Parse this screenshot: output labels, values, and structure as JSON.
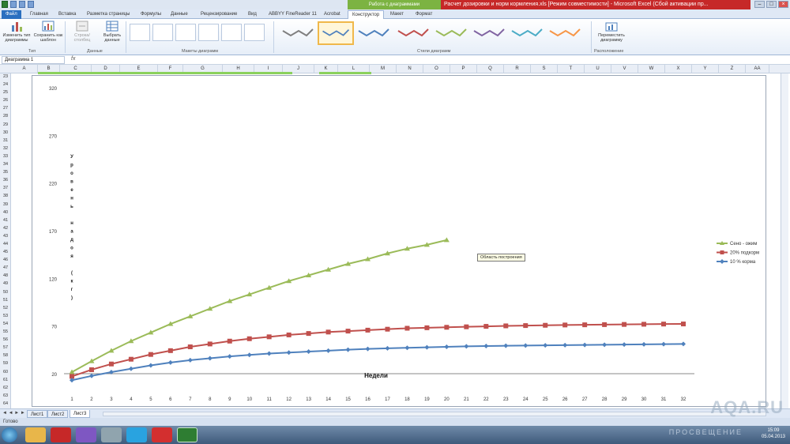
{
  "window": {
    "title": "Расчет дозировки и норм кормления.xls [Режим совместимости] - Microsoft Excel (Сбой активации пр...",
    "context_group": "Работа с диаграммами"
  },
  "ribbon": {
    "tabs": [
      "Файл",
      "Главная",
      "Вставка",
      "Разметка страницы",
      "Формулы",
      "Данные",
      "Рецензирование",
      "Вид",
      "ABBYY FineReader 11",
      "Acrobat",
      "Конструктор",
      "Макет",
      "Формат"
    ],
    "active_tab": "Конструктор",
    "buttons": {
      "change_type": "Изменить тип диаграммы",
      "save_template": "Сохранить как шаблон",
      "switch_row_col": "Строка/столбец",
      "select_data": "Выбрать данные",
      "move_chart": "Переместить диаграмму"
    },
    "groups": {
      "type": "Тип",
      "data": "Данные",
      "layouts": "Макеты диаграмм",
      "styles": "Стили диаграмм",
      "location": "Расположение"
    }
  },
  "formula_bar": {
    "name_box": "Диаграмма 1",
    "fx": "fx",
    "value": ""
  },
  "columns": [
    "A",
    "B",
    "C",
    "D",
    "E",
    "F",
    "G",
    "H",
    "I",
    "J",
    "K",
    "L",
    "M",
    "N",
    "O",
    "P",
    "Q",
    "R",
    "S",
    "T",
    "U",
    "V",
    "W",
    "X",
    "Y",
    "Z",
    "AA"
  ],
  "rows": [
    "23",
    "24",
    "25",
    "26",
    "27",
    "28",
    "29",
    "30",
    "31",
    "32",
    "33",
    "34",
    "35",
    "36",
    "37",
    "38",
    "39",
    "40",
    "41",
    "42",
    "43",
    "44",
    "45",
    "46",
    "47",
    "48",
    "49",
    "50",
    "51",
    "52",
    "53",
    "54",
    "55",
    "56",
    "57",
    "58",
    "59",
    "60",
    "61",
    "62",
    "63",
    "64"
  ],
  "chart_data": {
    "type": "line",
    "xlabel": "Недели",
    "ylabel": "Уровень надоя (кг)",
    "x": [
      1,
      2,
      3,
      4,
      5,
      6,
      7,
      8,
      9,
      10,
      11,
      12,
      13,
      14,
      15,
      16,
      17,
      18,
      19,
      20,
      21,
      22,
      23,
      24,
      25,
      26,
      27,
      28,
      29,
      30,
      31,
      32
    ],
    "ytick_labels": [
      "20",
      "70",
      "120",
      "170",
      "220",
      "270",
      "320"
    ],
    "ylim": [
      20,
      320
    ],
    "legend_position": "right",
    "series": [
      {
        "name": "Сено - ожим",
        "color": "#9bbb59",
        "marker": "triangle",
        "values": [
          22.5,
          34,
          45,
          55,
          64,
          73,
          81,
          89,
          97,
          104,
          111,
          118,
          124,
          130,
          136,
          141,
          147,
          152,
          156,
          161
        ]
      },
      {
        "name": "20% подкорм",
        "color": "#c0504d",
        "marker": "square",
        "values": [
          18,
          25,
          31,
          36,
          41,
          45,
          49,
          52,
          55,
          57.5,
          59.5,
          61.5,
          63,
          64.5,
          65.5,
          66.5,
          67.5,
          68.5,
          69,
          69.5,
          70,
          70.5,
          71,
          71.3,
          71.6,
          71.9,
          72.1,
          72.3,
          72.5,
          72.7,
          72.9,
          73
        ]
      },
      {
        "name": "10 % корма",
        "color": "#4f81bd",
        "marker": "diamond",
        "values": [
          14,
          18.5,
          22.5,
          26,
          29.5,
          32.5,
          35,
          37,
          39,
          40.5,
          42,
          43,
          44,
          45,
          46,
          46.8,
          47.5,
          48,
          48.5,
          49,
          49.5,
          49.8,
          50.1,
          50.4,
          50.6,
          50.8,
          51,
          51.2,
          51.4,
          51.6,
          51.8,
          52
        ]
      }
    ]
  },
  "tooltip": "Область построения",
  "sheets": [
    "Лист1",
    "Лист2",
    "Лист3"
  ],
  "active_sheet": "Лист3",
  "status": "Готово",
  "clock": {
    "time": "15:09",
    "date": "05.04.2013"
  },
  "watermark": "AQA.RU",
  "watermark_sub": "ПРОСВЕЩЕНИЕ"
}
